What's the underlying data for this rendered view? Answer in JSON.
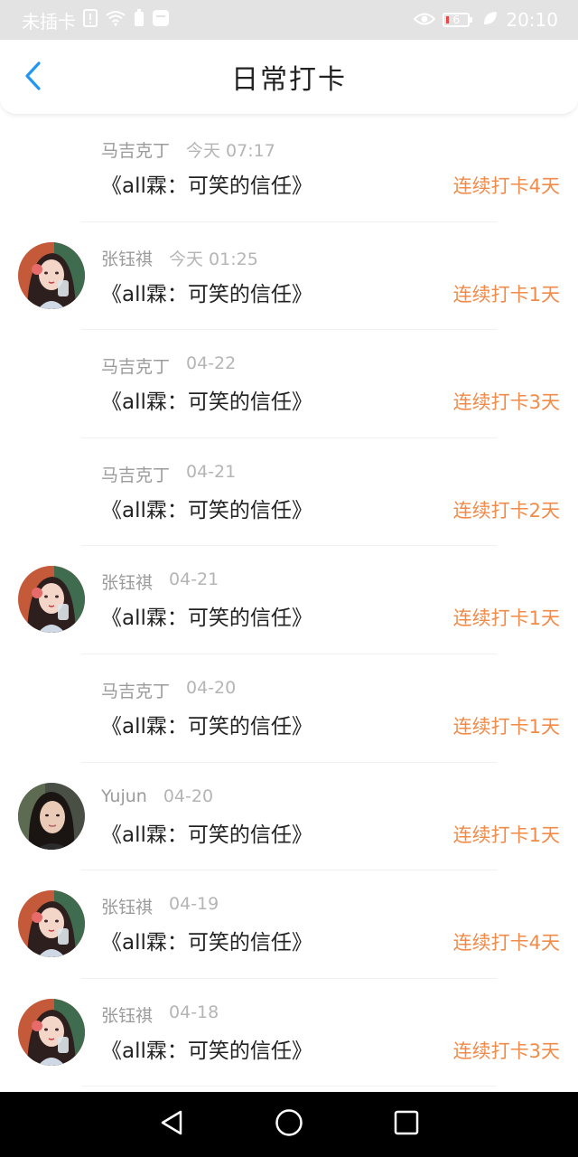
{
  "status_bar": {
    "carrier": "未插卡",
    "battery_level": "6",
    "time": "20:10",
    "icons": [
      "sim-alert-icon",
      "wifi-icon",
      "battery-small-icon",
      "notification-icon",
      "eye-icon",
      "battery-icon",
      "leaf-icon"
    ]
  },
  "header": {
    "title": "日常打卡",
    "back_icon": "chevron-left-icon",
    "accent_color": "#2196f3"
  },
  "checkins": [
    {
      "user": "马吉克丁",
      "time": "今天 07:17",
      "book": "《all霖：可笑的信任》",
      "streak": "连续打卡4天",
      "avatar": "none"
    },
    {
      "user": "张钰祺",
      "time": "今天 01:25",
      "book": "《all霖：可笑的信任》",
      "streak": "连续打卡1天",
      "avatar": "illustrated-girl"
    },
    {
      "user": "马吉克丁",
      "time": "04-22",
      "book": "《all霖：可笑的信任》",
      "streak": "连续打卡3天",
      "avatar": "none"
    },
    {
      "user": "马吉克丁",
      "time": "04-21",
      "book": "《all霖：可笑的信任》",
      "streak": "连续打卡2天",
      "avatar": "none"
    },
    {
      "user": "张钰祺",
      "time": "04-21",
      "book": "《all霖：可笑的信任》",
      "streak": "连续打卡1天",
      "avatar": "illustrated-girl"
    },
    {
      "user": "马吉克丁",
      "time": "04-20",
      "book": "《all霖：可笑的信任》",
      "streak": "连续打卡1天",
      "avatar": "none"
    },
    {
      "user": "Yujun",
      "time": "04-20",
      "book": "《all霖：可笑的信任》",
      "streak": "连续打卡1天",
      "avatar": "photo-girl"
    },
    {
      "user": "张钰祺",
      "time": "04-19",
      "book": "《all霖：可笑的信任》",
      "streak": "连续打卡4天",
      "avatar": "illustrated-girl"
    },
    {
      "user": "张钰祺",
      "time": "04-18",
      "book": "《all霖：可笑的信任》",
      "streak": "连续打卡3天",
      "avatar": "illustrated-girl"
    }
  ],
  "colors": {
    "streak": "#f08b4a",
    "username": "#9b9b9b",
    "status_bar_bg": "#e3e3e3"
  },
  "system_nav": {
    "icons": [
      "back-triangle-icon",
      "home-circle-icon",
      "recents-square-icon"
    ]
  }
}
